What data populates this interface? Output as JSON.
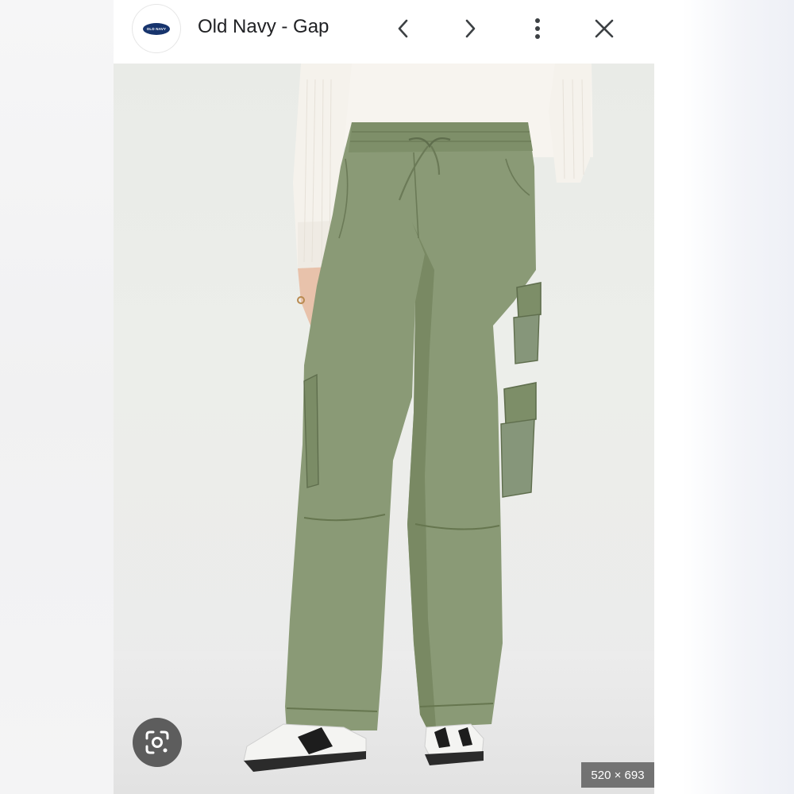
{
  "header": {
    "favicon_text": "OLD NAVY",
    "title": "Old Navy - Gap",
    "icons": [
      "chevron-left-icon",
      "chevron-right-icon",
      "more-vert-icon",
      "close-icon"
    ]
  },
  "image": {
    "dimensions_label": "520 × 693",
    "lens_icon": "google-lens-icon"
  },
  "colors": {
    "pants": "#8a9a76",
    "pants_shadow": "#6f7f5d",
    "sweater": "#f6f3ee",
    "title_text": "#202124",
    "logo_navy": "#17346d"
  }
}
